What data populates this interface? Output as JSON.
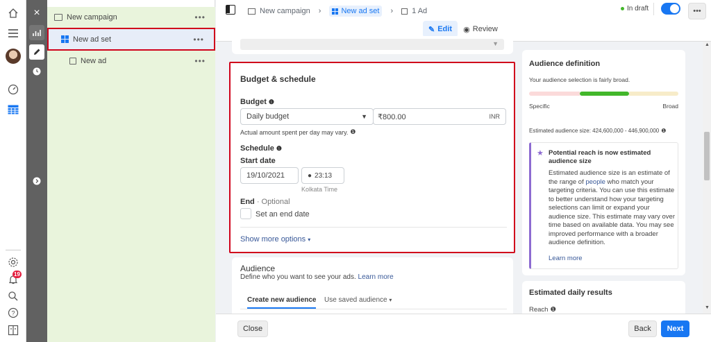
{
  "left_nav": {
    "notifications_count": "19"
  },
  "tree": {
    "campaign_label": "New campaign",
    "adset_label": "New ad set",
    "ad_label": "New ad",
    "more_label": "•••"
  },
  "topbar": {
    "crumb_campaign": "New campaign",
    "crumb_adset": "New ad set",
    "crumb_ad": "1 Ad",
    "status": "In draft",
    "edit_label": "Edit",
    "review_label": "Review",
    "more_label": "•••"
  },
  "budget": {
    "title": "Budget & schedule",
    "budget_label": "Budget",
    "budget_type": "Daily budget",
    "amount": "₹800.00",
    "currency": "INR",
    "note": "Actual amount spent per day may vary.",
    "schedule_label": "Schedule",
    "start_date_label": "Start date",
    "start_date": "19/10/2021",
    "start_time": "23:13",
    "timezone": "Kolkata Time",
    "end_label": "End",
    "end_optional": " · Optional",
    "end_checkbox_label": "Set an end date",
    "show_more": "Show more options"
  },
  "audience": {
    "title": "Audience",
    "description": "Define who you want to see your ads.",
    "learn_more": "Learn more",
    "tab_new": "Create new audience",
    "tab_saved": "Use saved audience"
  },
  "audience_definition": {
    "title": "Audience definition",
    "subtitle": "Your audience selection is fairly broad.",
    "specific": "Specific",
    "broad": "Broad",
    "estimated_size": "Estimated audience size: 424,600,000 - 446,900,000",
    "reach_title": "Potential reach is now estimated audience size",
    "reach_body_1": "Estimated audience size is an estimate of the range of ",
    "reach_body_link": "people",
    "reach_body_2": " who match your targeting criteria. You can use this estimate to better understand how your targeting selections can limit or expand your audience size. This estimate may vary over time based on available data. You may see improved performance with a broader audience definition.",
    "learn_more": "Learn more"
  },
  "daily_results": {
    "title": "Estimated daily results",
    "reach_label": "Reach"
  },
  "bottombar": {
    "close_label": "Close",
    "back_label": "Back",
    "next_label": "Next"
  },
  "colors": {
    "accent": "#1877f2",
    "selection_border": "#d0021b",
    "tree_bg": "#e9f4dc",
    "gauge_green": "#42b72a",
    "gauge_red": "#fbdada",
    "gauge_yellow": "#f7ecc9",
    "tip_border": "#8d6bd1"
  },
  "icons": {
    "home": "home-icon",
    "menu": "hamburger-icon",
    "dashboard": "gauge-icon",
    "table": "table-icon",
    "settings": "gear-icon",
    "bell": "bell-icon",
    "search": "search-icon",
    "help": "question-icon",
    "columns": "columns-icon"
  }
}
